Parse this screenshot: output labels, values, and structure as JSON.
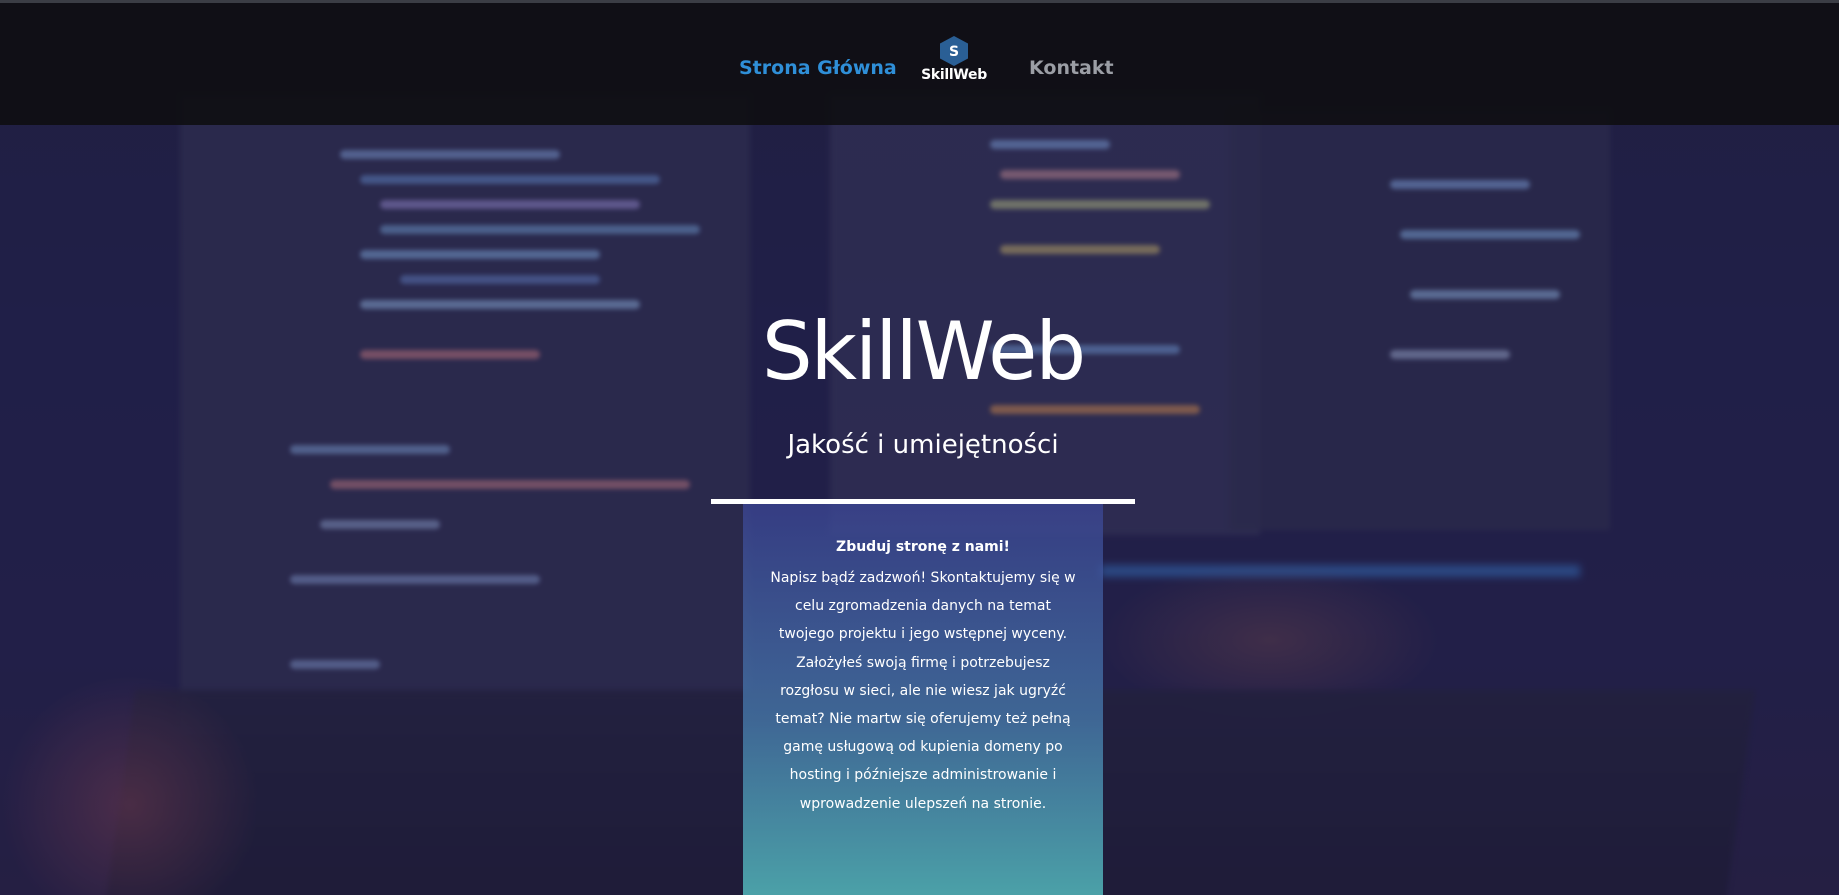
{
  "nav": {
    "home_label": "Strona Główna",
    "contact_label": "Kontakt",
    "logo_letter": "S",
    "logo_text": "SkillWeb"
  },
  "hero": {
    "title": "SkillWeb",
    "subtitle": "Jakość i umiejętności"
  },
  "card": {
    "heading": "Zbuduj stronę z nami!",
    "body": "Napisz bądź zadzwoń! Skontaktujemy się w celu zgromadzenia danych na temat twojego projektu i jego wstępnej wyceny. Założyłeś swoją firmę i potrzebujesz rozgłosu w sieci, ale nie wiesz jak ugryźć temat? Nie martw się oferujemy też pełną gamę usługową od kupienia domeny po hosting i późniejsze administrowanie i wprowadzenie ulepszeń na stronie."
  },
  "colors": {
    "nav_active": "#2f8fd8",
    "nav_inactive": "#9b9ea5",
    "logo_hex": "#2a5f95",
    "text": "#ffffff"
  },
  "icons": {
    "logo": "hexagon-logo-icon"
  }
}
